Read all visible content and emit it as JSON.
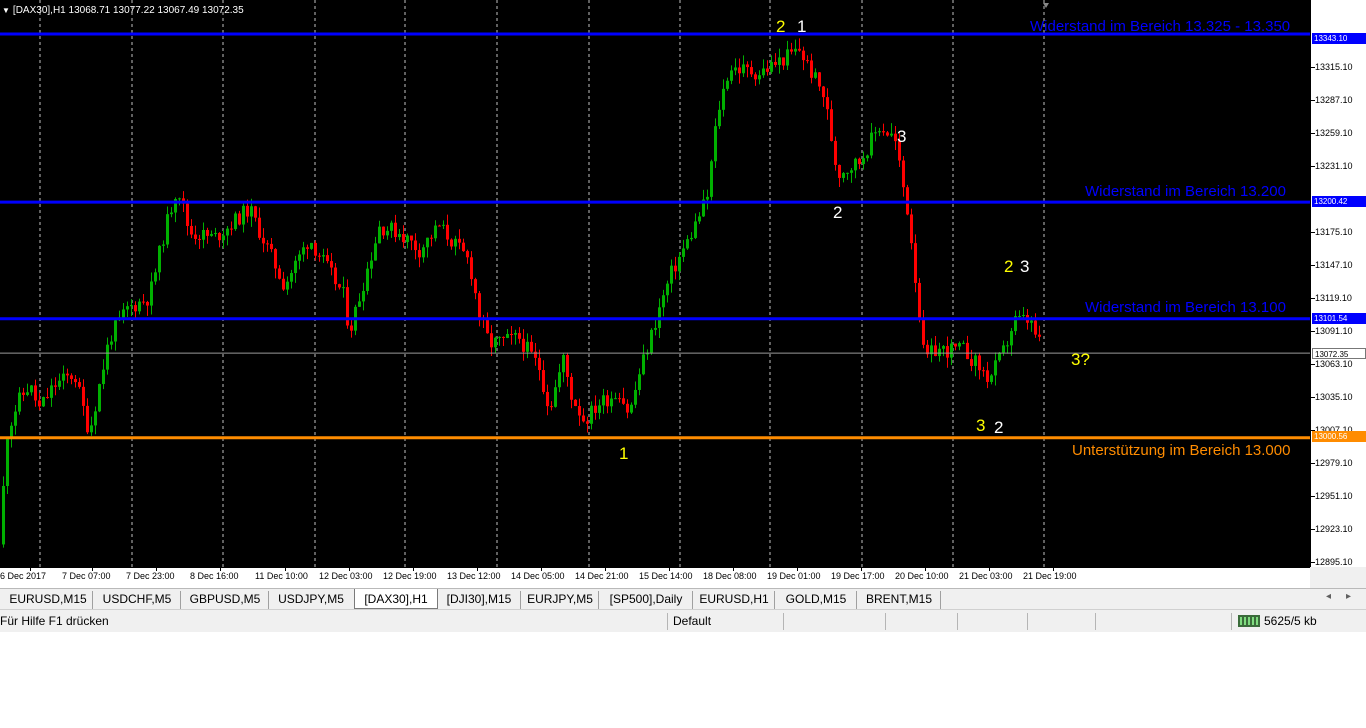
{
  "chart_header": {
    "arrow": "▼",
    "text": "[DAX30],H1  13068.71 13077.22 13067.49 13072.35"
  },
  "colors": {
    "background": "#000000",
    "resistance": "#0000ff",
    "support": "#ff8c00",
    "bull": "#00b000",
    "bear": "#ff0000",
    "wave_yellow": "#ffff00",
    "wave_white": "#ffffff"
  },
  "price_axis": {
    "ticks": [
      "13315.10",
      "13287.10",
      "13259.10",
      "13231.10",
      "13175.10",
      "13147.10",
      "13119.10",
      "13091.10",
      "13063.10",
      "13035.10",
      "13007.10",
      "12979.10",
      "12951.10",
      "12923.10",
      "12895.10"
    ],
    "level_boxes": [
      "13343.10",
      "13200.42",
      "13101.54",
      "13072.35",
      "13000.56"
    ]
  },
  "time_axis": [
    "6 Dec 2017",
    "7 Dec 07:00",
    "7 Dec 23:00",
    "8 Dec 16:00",
    "11 Dec 10:00",
    "12 Dec 03:00",
    "12 Dec 19:00",
    "13 Dec 12:00",
    "14 Dec 05:00",
    "14 Dec 21:00",
    "15 Dec 14:00",
    "18 Dec 08:00",
    "19 Dec 01:00",
    "19 Dec 17:00",
    "20 Dec 10:00",
    "21 Dec 03:00",
    "21 Dec 19:00"
  ],
  "levels": [
    {
      "label": "Widerstand im Bereich 13.325 - 13.350",
      "price": 13343.1,
      "type": "resistance"
    },
    {
      "label": "Widerstand im Bereich 13.200",
      "price": 13200.42,
      "type": "resistance"
    },
    {
      "label": "Widerstand im Bereich 13.100",
      "price": 13101.54,
      "type": "resistance"
    },
    {
      "label": "Unterstützung im Bereich 13.000",
      "price": 13000.56,
      "type": "support"
    }
  ],
  "wave_labels": [
    "1",
    "2",
    "1",
    "3",
    "2",
    "2",
    "3",
    "3?",
    "3",
    "2"
  ],
  "tabs": [
    "EURUSD,M15",
    "USDCHF,M5",
    "GBPUSD,M5",
    "USDJPY,M5",
    "[DAX30],H1",
    "[DJI30],M15",
    "EURJPY,M5",
    "[SP500],Daily",
    "EURUSD,H1",
    "GOLD,M15",
    "BRENT,M15"
  ],
  "active_tab": "[DAX30],H1",
  "tab_nav": {
    "prev": "◂",
    "next": "▸"
  },
  "status": {
    "help": "Für Hilfe F1 drücken",
    "profile": "Default",
    "traffic": "5625/5 kb"
  }
}
